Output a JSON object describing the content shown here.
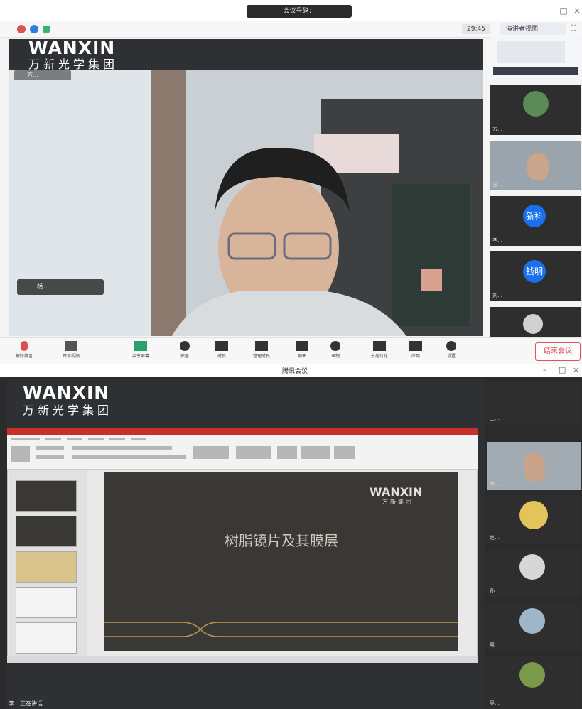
{
  "window1": {
    "title": "会议号码：",
    "timer": "29:45",
    "view_button": "演讲者视图",
    "logo_en": "WANXIN",
    "logo_cn": "万新光学集团",
    "speaker_tag": "方…",
    "subtitle_label": "杨…",
    "toolbar": {
      "items": [
        "解除静音",
        "开启视频",
        "共享屏幕",
        "安全",
        "成员",
        "管理成员",
        "聊天",
        "录制",
        "分组讨论",
        "应用",
        "设置"
      ],
      "end_button": "结束会议"
    },
    "thumbs": [
      {
        "label": "方…",
        "avatar": ""
      },
      {
        "label": "甘…",
        "avatar": ""
      },
      {
        "label": "李…",
        "avatar": ""
      },
      {
        "label": "张…",
        "avatar": "新科"
      },
      {
        "label": "刘…",
        "avatar": "钱明"
      },
      {
        "label": "",
        "avatar": ""
      }
    ]
  },
  "window2": {
    "title": "腾讯会议",
    "logo_en": "WANXIN",
    "logo_cn": "万新光学集团",
    "slide_logo_en": "WANXIN",
    "slide_logo_cn": "万新集团",
    "slide_title": "树脂镜片及其膜层",
    "bottom_label": "李…正在讲话",
    "thumbs": [
      {
        "label": "王…"
      },
      {
        "label": "李…"
      },
      {
        "label": "赵…"
      },
      {
        "label": "孙…"
      },
      {
        "label": "周…"
      },
      {
        "label": "吴…"
      }
    ]
  },
  "colors": {
    "toolbar_green": "#2aa06a",
    "end_red": "#e3515c",
    "avatar_blue": "#1a6ef0",
    "ppt_red": "#c9302c"
  }
}
